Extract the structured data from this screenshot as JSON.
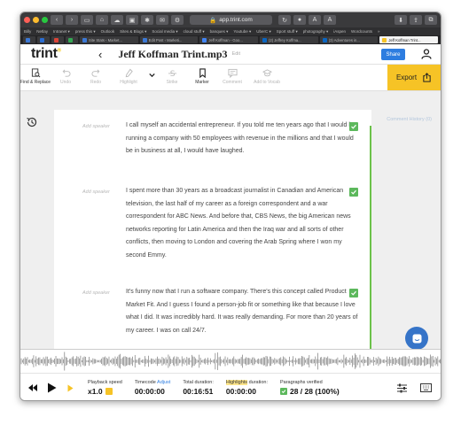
{
  "browser": {
    "url": "app.trint.com",
    "font_controls": [
      "A",
      "A"
    ],
    "bookmarks": [
      "Billy",
      "Netlay",
      "Intranet ▾",
      "press this ▾",
      "Outlook",
      "Sites & Blogs ▾",
      "Social media ▾",
      "cloud stuff ▾",
      "banques ▾",
      "Youtube ▾",
      "UberC ▾",
      "Sport stuff ▾",
      "photography ▾",
      "iAspen",
      "Wordcounts",
      "»"
    ],
    "tabs": [
      "Site Stats ‹ Market...",
      "Edit Post ‹ Marketi...",
      "Jeff Koffman - Goo...",
      "(2) Jeffrey Koffma...",
      "(3) Adventures in...",
      "Jeff Koffman Trint..."
    ]
  },
  "app": {
    "logo": "trint",
    "logo_mark": "®",
    "back": "‹",
    "title": "Jeff Koffman Trint.mp3",
    "edit_label": "Edit",
    "share_label": "Share"
  },
  "toolbar": {
    "tools": [
      "Find & Replace",
      "Undo",
      "Redo",
      "Highlight",
      "Strike",
      "Marker",
      "Comment",
      "Add to Vocab"
    ],
    "export_label": "Export"
  },
  "content": {
    "comment_history": "Comment History (0)",
    "paragraphs": [
      {
        "speaker": "Add speaker",
        "text": "I call myself an accidental entrepreneur. If you told me ten years ago that I would be running a company with 50 employees with revenue in the millions and that I would be in business at all, I would have laughed."
      },
      {
        "speaker": "Add speaker",
        "text": "I spent more than 30 years as a broadcast journalist in Canadian and American television, the last half of my career as a foreign correspondent and a war correspondent for ABC News. And before that, CBS News, the big American news networks reporting for Latin America and then the Iraq war and all sorts of other conflicts, then moving to London and covering the Arab Spring where I won my second Emmy."
      },
      {
        "speaker": "Add speaker",
        "text": "It's funny now that I run a software company. There's this concept called Product Market Fit. And I guess I found a person-job fit or something like that because I love what I did. It was incredibly hard. It was really demanding. For more than 20 years of my career. I was on call 24/7."
      }
    ]
  },
  "player": {
    "speed_label": "Playback speed",
    "speed_value": "x1.0",
    "timecode_label": "Timecode",
    "adjust_label": "Adjust",
    "timecode_value": "00:00:00",
    "total_label": "Total duration:",
    "total_value": "00:16:51",
    "highlights_label": "Highlights",
    "highlights_suffix": " duration:",
    "highlights_value": "00:00:00",
    "verified_label": "Paragraphs verified",
    "verified_value": "28 / 28 (100%)"
  },
  "colors": {
    "accent_blue": "#2d7de0",
    "export_yellow": "#f6c326",
    "verified_green": "#5cb85c"
  }
}
